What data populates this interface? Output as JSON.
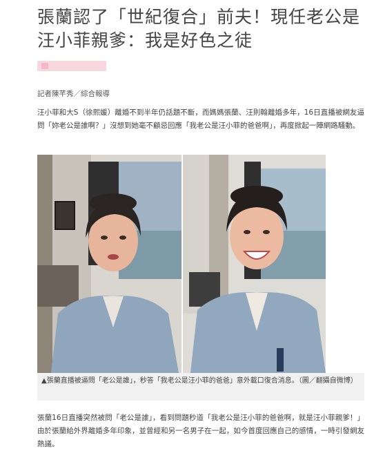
{
  "article": {
    "title": "張蘭認了「世紀復合」前夫！現任老公是汪小菲親爹：我是好色之徒",
    "byline": "記者陳芊秀／綜合報導",
    "paragraph1": "汪小菲和大S（徐熙媛）離婚不到半年仍話題不斷，而媽媽張蘭、汪則翰離婚多年，16日直播被網友逼問「妳老公是誰啊？」沒想到她毫不顧忌回應「我老公是汪小菲的爸爸啊」，再度掀起一陣網路騷動。",
    "caption": "▲張蘭直播被逼問「老公是誰」，秒答「我老公是汪小菲的爸爸」意外載口復合消息。（圖／翻攝自微博）",
    "paragraph2": "張蘭16日直播突然被問「老公是誰」，看到問題秒道「我老公是汪小菲的爸爸啊，就是汪小菲親爹！」由於張蘭給外界離婚多年印象，並曾經和另一名男子在一起，如今首度回應自己的感情，一時引發網友熱議。"
  },
  "colors": {
    "title": "#444444",
    "pink_bar": "#f7d6e0",
    "caption_bg": "#f1f1f1"
  }
}
